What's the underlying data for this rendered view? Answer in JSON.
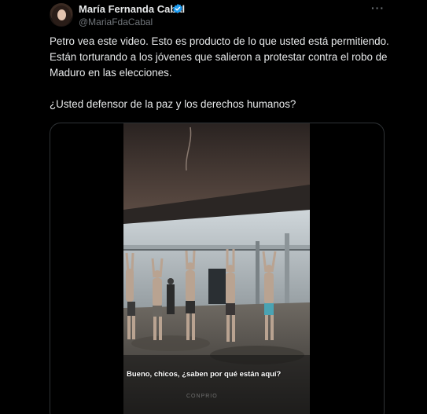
{
  "author": {
    "display_name": "María Fernanda Cabal",
    "handle": "@MariaFdaCabal",
    "verified": true,
    "avatar_icon": "profile-photo"
  },
  "tweet": {
    "paragraph_1": "Petro vea este video. Esto es producto de lo que usted está permitiendo. Están torturando a los jóvenes que salieron a protestar contra el robo de Maduro en las elecciones.",
    "paragraph_2": "¿Usted defensor de la paz y los derechos humanos?"
  },
  "media": {
    "caption": "Bueno, chicos, ¿saben por qué están aquí?",
    "watermark": "CONPRIO"
  },
  "colors": {
    "background": "#000000",
    "text": "#e7e9ea",
    "secondary_text": "#71767b",
    "verified_badge": "#1d9bf0",
    "border": "#2f3336"
  },
  "icons": {
    "more": "more-options-icon",
    "verified": "verified-badge-icon"
  }
}
